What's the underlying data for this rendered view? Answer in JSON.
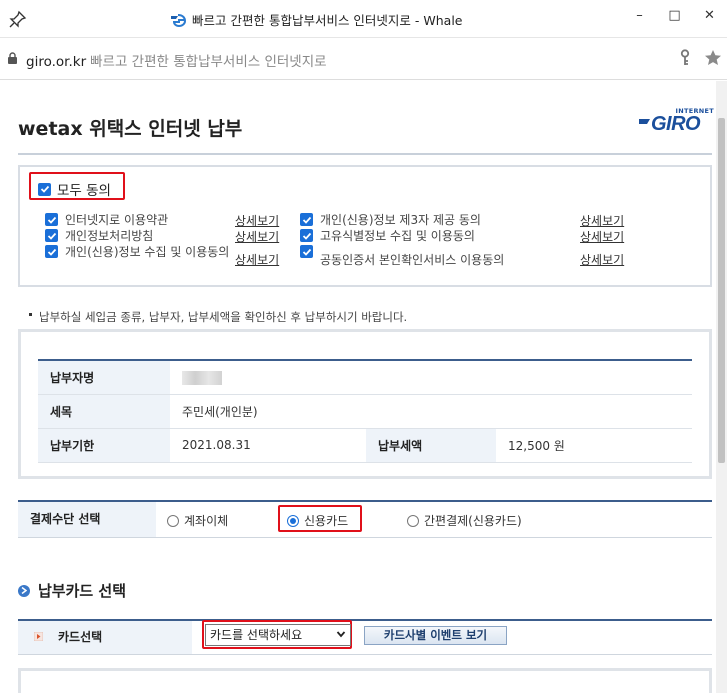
{
  "window": {
    "title": "빠르고 간편한 통합납부서비스 인터넷지로 - Whale",
    "minimize": "–",
    "maximize": "□",
    "close": "✕"
  },
  "address": {
    "domain": "giro.or.kr",
    "page_title": "빠르고 간편한 통합납부서비스 인터넷지로"
  },
  "page": {
    "title": "wetax 위택스 인터넷 납부",
    "logo_top": "INTERNET",
    "logo_main": "GIRO"
  },
  "agreements": {
    "agree_all": "모두 동의",
    "detail_label": "상세보기",
    "items": [
      {
        "label": "인터넷지로 이용약관",
        "checked": true
      },
      {
        "label": "개인정보처리방침",
        "checked": true
      },
      {
        "label": "개인(신용)정보 수집 및 이용동의",
        "checked": true
      },
      {
        "label": "개인(신용)정보 제3자 제공 동의",
        "checked": true
      },
      {
        "label": "고유식별정보 수집 및 이용동의",
        "checked": true
      },
      {
        "label": "공동인증서 본인확인서비스 이용동의",
        "checked": true
      }
    ]
  },
  "notice": "납부하실 세입금 종류, 납부자, 납부세액을 확인하신 후 납부하시기 바랍니다.",
  "info": {
    "payer_label": "납부자명",
    "tax_item_label": "세목",
    "tax_item_value": "주민세(개인분)",
    "due_label": "납부기한",
    "due_value": "2021.08.31",
    "amount_label": "납부세액",
    "amount_value": "12,500 원"
  },
  "payment_method": {
    "label": "결제수단 선택",
    "options": [
      "계좌이체",
      "신용카드",
      "간편결제(신용카드)"
    ],
    "selected": "신용카드"
  },
  "card_section": {
    "title": "납부카드 선택",
    "row_label": "카드선택",
    "select_value": "카드를 선택하세요",
    "event_button": "카드사별 이벤트 보기"
  },
  "colors": {
    "accent": "#1a6fd8",
    "highlight": "#e0101a",
    "table_header_bg": "#eef3f9",
    "table_border": "#3c5d8c"
  }
}
